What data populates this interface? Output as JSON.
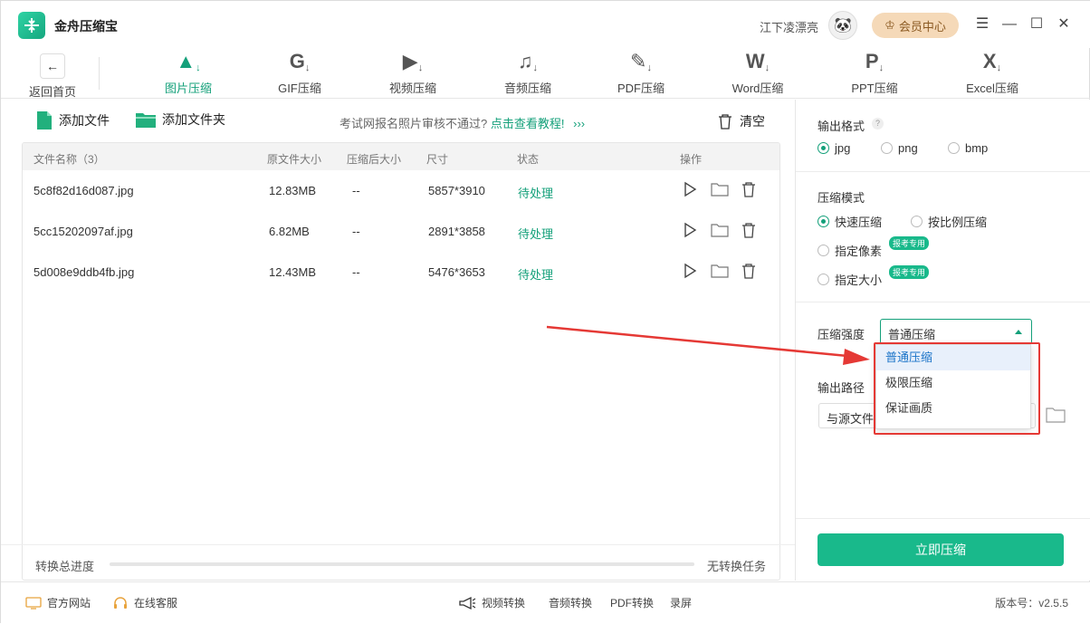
{
  "app": {
    "name": "金舟压缩宝",
    "user": "江下凌漂亮",
    "vip": "会员中心",
    "version": "版本号：v2.5.5"
  },
  "toolbar": {
    "back": "返回首页",
    "tools": [
      {
        "label": "图片压缩",
        "icon": "image-compress-icon",
        "glyph": "▲",
        "active": true
      },
      {
        "label": "GIF压缩",
        "icon": "gif-compress-icon",
        "glyph": "G",
        "active": false
      },
      {
        "label": "视频压缩",
        "icon": "video-compress-icon",
        "glyph": "▶",
        "active": false
      },
      {
        "label": "音频压缩",
        "icon": "audio-compress-icon",
        "glyph": "♫",
        "active": false
      },
      {
        "label": "PDF压缩",
        "icon": "pdf-compress-icon",
        "glyph": "✎",
        "active": false
      },
      {
        "label": "Word压缩",
        "icon": "word-compress-icon",
        "glyph": "W",
        "active": false
      },
      {
        "label": "PPT压缩",
        "icon": "ppt-compress-icon",
        "glyph": "P",
        "active": false
      },
      {
        "label": "Excel压缩",
        "icon": "excel-compress-icon",
        "glyph": "X",
        "active": false
      }
    ]
  },
  "actions": {
    "add_file": "添加文件",
    "add_folder": "添加文件夹",
    "hint": "考试网报名照片审核不通过?",
    "hint_link": "点击查看教程!",
    "hint_arrows": "›››",
    "clear": "清空"
  },
  "table": {
    "headers": {
      "name": "文件名称（3）",
      "orig": "原文件大小",
      "after": "压缩后大小",
      "size": "尺寸",
      "status": "状态",
      "ops": "操作"
    },
    "rows": [
      {
        "name": "5c8f82d16d087.jpg",
        "orig": "12.83MB",
        "after": "--",
        "size": "5857*3910",
        "status": "待处理"
      },
      {
        "name": "5cc15202097af.jpg",
        "orig": "6.82MB",
        "after": "--",
        "size": "2891*3858",
        "status": "待处理"
      },
      {
        "name": "5d008e9ddb4fb.jpg",
        "orig": "12.43MB",
        "after": "--",
        "size": "5476*3653",
        "status": "待处理"
      }
    ]
  },
  "progress": {
    "label": "转换总进度",
    "status": "无转换任务",
    "value": 0
  },
  "settings": {
    "format_title": "输出格式",
    "help": "?",
    "formats": [
      "jpg",
      "png",
      "bmp"
    ],
    "format_selected": "jpg",
    "mode_title": "压缩模式",
    "modes": {
      "fast": "快速压缩",
      "ratio": "按比例压缩",
      "pixel": "指定像素",
      "size": "指定大小"
    },
    "tag": "报考专用",
    "strength_title": "压缩强度",
    "strength_value": "普通压缩",
    "strength_options": [
      "普通压缩",
      "极限压缩",
      "保证画质"
    ],
    "output_title": "输出路径",
    "output_value": "与源文件目录",
    "start": "立即压缩"
  },
  "footer": {
    "site": "官方网站",
    "service": "在线客服",
    "video": "视频转换",
    "audio": "音频转换",
    "pdf": "PDF转换",
    "record": "录屏"
  },
  "colors": {
    "accent": "#19b98b",
    "annotation": "#e53935"
  }
}
